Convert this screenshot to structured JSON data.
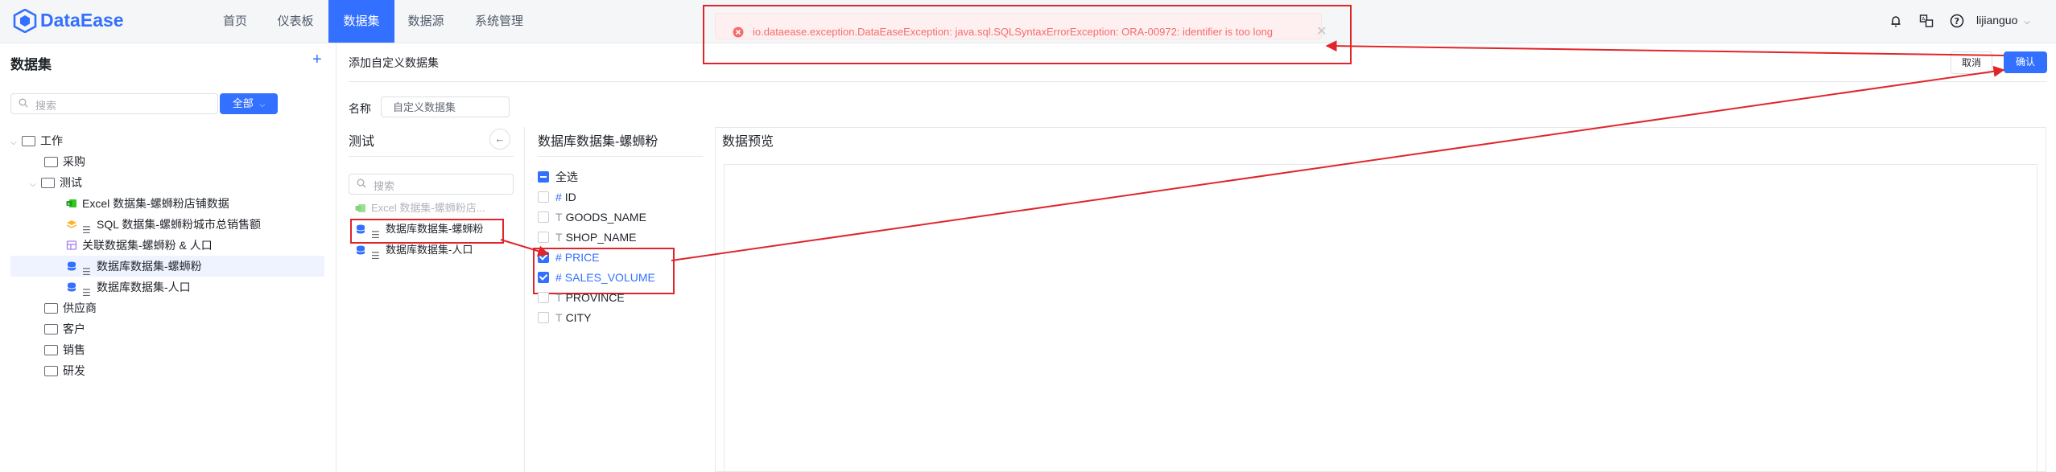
{
  "app": {
    "name": "DataEase"
  },
  "nav": [
    {
      "label": "首页",
      "active": false
    },
    {
      "label": "仪表板",
      "active": false
    },
    {
      "label": "数据集",
      "active": true
    },
    {
      "label": "数据源",
      "active": false
    },
    {
      "label": "系统管理",
      "active": false
    }
  ],
  "user": {
    "name": "lijianguo"
  },
  "toast": {
    "message": "io.dataease.exception.DataEaseException: java.sql.SQLSyntaxErrorException: ORA-00972: identifier is too long"
  },
  "sidebar": {
    "title": "数据集",
    "add_icon": "+",
    "search_placeholder": "搜索",
    "filter_label": "全部",
    "tree": [
      {
        "label": "工作",
        "kind": "folder"
      },
      {
        "label": "采购",
        "kind": "folder"
      },
      {
        "label": "测试",
        "kind": "folder"
      },
      {
        "label": "Excel 数据集-螺蛳粉店铺数据",
        "kind": "excel"
      },
      {
        "label": "SQL 数据集-螺蛳粉城市总销售额",
        "kind": "sql"
      },
      {
        "label": "关联数据集-螺蛳粉 & 人口",
        "kind": "union"
      },
      {
        "label": "数据库数据集-螺蛳粉",
        "kind": "db"
      },
      {
        "label": "数据库数据集-人口",
        "kind": "db"
      },
      {
        "label": "供应商",
        "kind": "folder"
      },
      {
        "label": "客户",
        "kind": "folder"
      },
      {
        "label": "销售",
        "kind": "folder"
      },
      {
        "label": "研发",
        "kind": "folder"
      }
    ]
  },
  "main": {
    "title": "添加自定义数据集",
    "cancel_label": "取消",
    "confirm_label": "确认",
    "name_label": "名称",
    "name_value": "自定义数据集",
    "group_panel": {
      "title": "测试",
      "search_placeholder": "搜索",
      "items": [
        {
          "label": "Excel 数据集-螺蛳粉店...",
          "disabled": true
        },
        {
          "label": "数据库数据集-螺蛳粉",
          "disabled": false
        },
        {
          "label": "数据库数据集-人口",
          "disabled": false
        }
      ]
    },
    "field_panel": {
      "title": "数据库数据集-螺蛳粉",
      "select_all_label": "全选",
      "fields": [
        {
          "type": "#",
          "name": "ID",
          "checked": false
        },
        {
          "type": "T",
          "name": "GOODS_NAME",
          "checked": false
        },
        {
          "type": "T",
          "name": "SHOP_NAME",
          "checked": false
        },
        {
          "type": "#",
          "name": "PRICE",
          "checked": true
        },
        {
          "type": "#",
          "name": "SALES_VOLUME",
          "checked": true
        },
        {
          "type": "T",
          "name": "PROVINCE",
          "checked": false
        },
        {
          "type": "T",
          "name": "CITY",
          "checked": false
        }
      ]
    },
    "preview": {
      "title": "数据预览"
    }
  },
  "colors": {
    "accent": "#3370ff",
    "annotation_red": "#e0252a",
    "error": "#f56c6c"
  }
}
